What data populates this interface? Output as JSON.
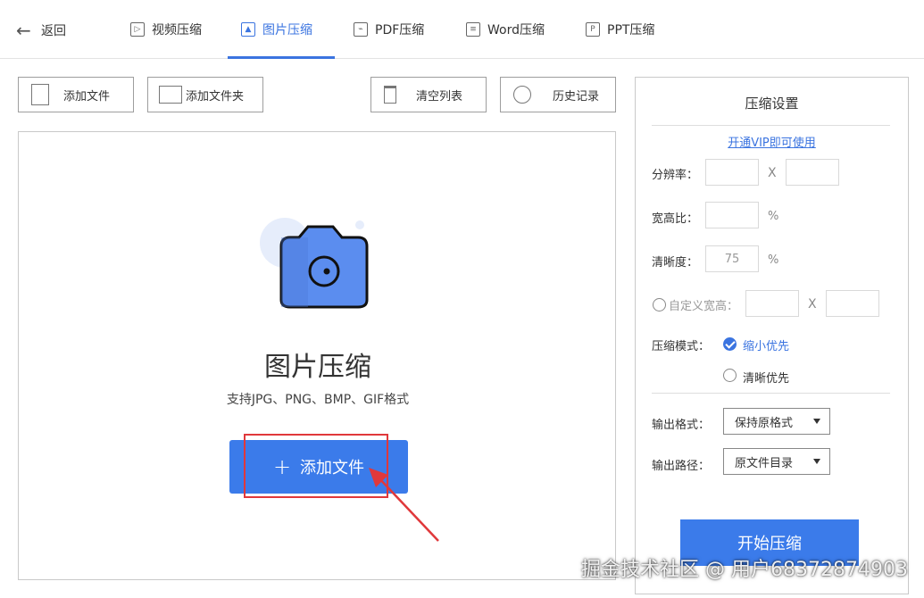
{
  "nav": {
    "back_label": "返回",
    "tabs": [
      {
        "label": "视频压缩",
        "icon": "video-file-icon",
        "glyph": "▷"
      },
      {
        "label": "图片压缩",
        "icon": "image-file-icon",
        "glyph": "▲"
      },
      {
        "label": "PDF压缩",
        "icon": "pdf-file-icon",
        "glyph": "⌁"
      },
      {
        "label": "Word压缩",
        "icon": "word-file-icon",
        "glyph": "≡"
      },
      {
        "label": "PPT压缩",
        "icon": "ppt-file-icon",
        "glyph": "P"
      }
    ],
    "active_tab": "图片压缩"
  },
  "toolbar": {
    "add_file": "添加文件",
    "add_folder": "添加文件夹",
    "clear_list": "清空列表",
    "history": "历史记录"
  },
  "drop": {
    "title": "图片压缩",
    "subtitle": "支持JPG、PNG、BMP、GIF格式",
    "add_button": "添加文件",
    "add_button_glyph": "+"
  },
  "settings": {
    "title": "压缩设置",
    "vip_link": "开通VIP即可使用",
    "resolution_label": "分辨率：",
    "aspect_label": "宽高比：",
    "clarity_label": "清晰度：",
    "clarity_value": "75",
    "custom_wh_label": "自定义宽高：",
    "x_symbol": "X",
    "percent_symbol": "%",
    "mode_label": "压缩模式：",
    "mode_options": [
      "缩小优先",
      "清晰优先"
    ],
    "mode_selected": "缩小优先",
    "output_format_label": "输出格式：",
    "output_format_value": "保持原格式",
    "output_path_label": "输出路径：",
    "output_path_value": "原文件目录",
    "start_button": "开始压缩"
  },
  "watermark": "掘金技术社区 @ 用户68372874903",
  "colors": {
    "accent": "#3b74e0",
    "button_blue": "#3b7bea",
    "highlight_red": "#e0383b"
  }
}
